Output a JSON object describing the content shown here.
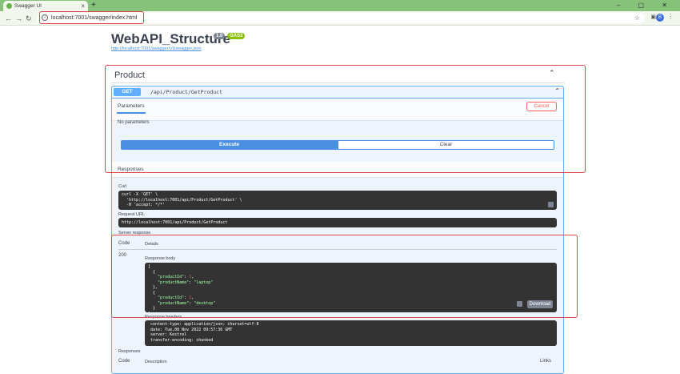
{
  "browser": {
    "tab_title": "Swagger UI",
    "tab_close": "×",
    "new_tab": "+",
    "window_buttons": "– ▢ ✕",
    "back": "←",
    "forward": "→",
    "reload": "↻",
    "url": "localhost:7001/swagger/index.html",
    "profile_initial": "B"
  },
  "swagger": {
    "title": "WebAPI_Structure",
    "version": "1.0",
    "oas": "OAS3",
    "spec_url": "http://localhost:7001/swagger/v1/swagger.json",
    "tag": "Product",
    "operation": {
      "method": "GET",
      "path": "/api/Product/GetProduct"
    },
    "parameters_tab": "Parameters",
    "cancel": "Cancel",
    "no_parameters": "No parameters",
    "execute": "Execute",
    "clear": "Clear",
    "responses_title": "Responses",
    "curl_label": "Curl",
    "curl_text": "curl -X 'GET' \\\n  'http://localhost:7001/api/Product/GetProduct' \\\n  -H 'accept: */*'",
    "request_url_label": "Request URL",
    "request_url": "http://localhost:7001/api/Product/GetProduct",
    "server_response_label": "Server response",
    "code_header": "Code",
    "details_header": "Details",
    "status_code": "200",
    "response_body_label": "Response body",
    "download": "Download",
    "response_headers_label": "Response headers",
    "response_headers_text": " content-type: application/json; charset=utf-8 \n date: Tue,08 Nov 2022 09:57:36 GMT \n server: Kestrel \n transfer-encoding: chunked ",
    "responses_label_2": "Responses",
    "description_header": "Description",
    "links_header": "Links"
  },
  "response_body": {
    "items": [
      {
        "key_id": "\"productId\"",
        "id": "1",
        "key_name": "\"productName\"",
        "name": "\"laptop\""
      },
      {
        "key_id": "\"productId\"",
        "id": "2",
        "key_name": "\"productName\"",
        "name": "\"desktop\""
      }
    ]
  },
  "colors": {
    "get": "#61affe",
    "execute": "#4990e2",
    "highlight": "#e1444c",
    "chrome": "#86c27a"
  }
}
